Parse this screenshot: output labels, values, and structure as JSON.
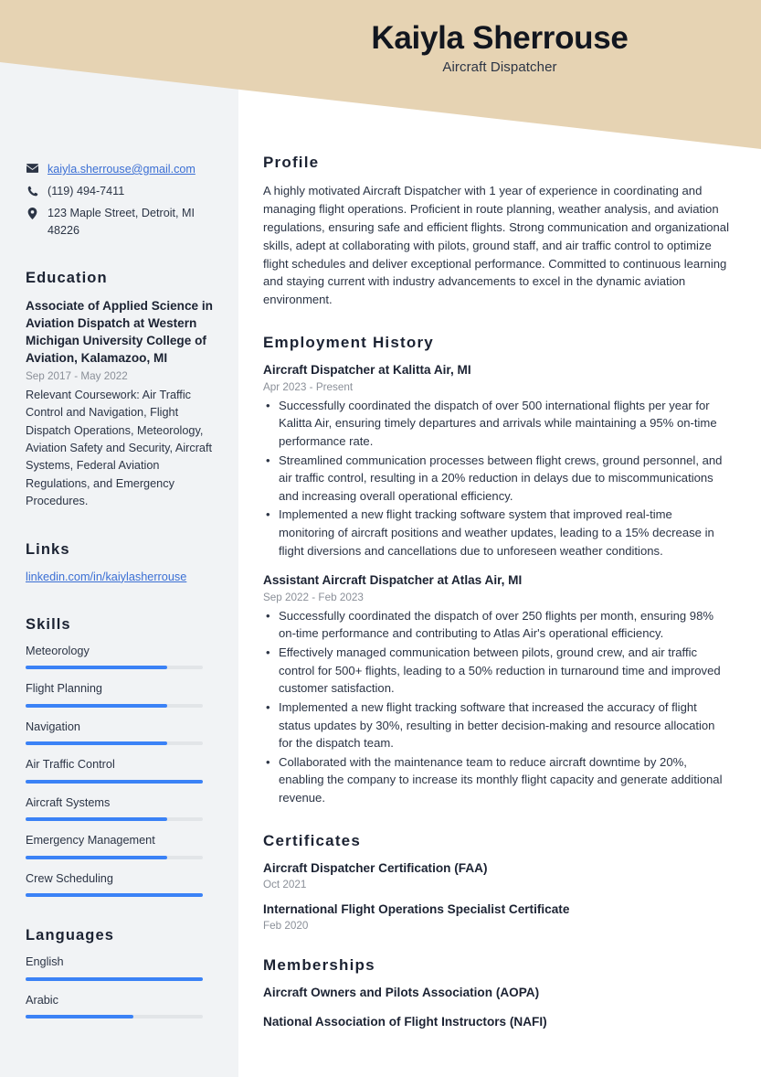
{
  "header": {
    "name": "Kaiyla Sherrouse",
    "job_title": "Aircraft Dispatcher",
    "banner_color": "#e6d3b3"
  },
  "theme": {
    "accent": "#3b82f6",
    "link": "#3b6fd4",
    "sidebar_bg": "#f1f3f5",
    "heading": "#1b2232",
    "muted": "#8b9099"
  },
  "sidebar": {
    "contact": [
      {
        "icon": "envelope-icon",
        "text": "kaiyla.sherrouse@gmail.com",
        "is_link": true
      },
      {
        "icon": "phone-icon",
        "text": "(119) 494-7411",
        "is_link": false
      },
      {
        "icon": "location-pin-icon",
        "text": "123 Maple Street, Detroit, MI 48226",
        "is_link": false
      }
    ],
    "education": {
      "heading": "Education",
      "degree": "Associate of Applied Science in Aviation Dispatch at Western Michigan University College of Aviation, Kalamazoo, MI",
      "date": "Sep 2017 - May 2022",
      "description": "Relevant Coursework: Air Traffic Control and Navigation, Flight Dispatch Operations, Meteorology, Aviation Safety and Security, Aircraft Systems, Federal Aviation Regulations, and Emergency Procedures."
    },
    "links": {
      "heading": "Links",
      "items": [
        {
          "label": "linkedin.com/in/kaiylasherrouse"
        }
      ]
    },
    "skills": {
      "heading": "Skills",
      "items": [
        {
          "label": "Meteorology",
          "level": 80
        },
        {
          "label": "Flight Planning",
          "level": 80
        },
        {
          "label": "Navigation",
          "level": 80
        },
        {
          "label": "Air Traffic Control",
          "level": 100
        },
        {
          "label": "Aircraft Systems",
          "level": 80
        },
        {
          "label": "Emergency Management",
          "level": 80
        },
        {
          "label": "Crew Scheduling",
          "level": 100
        }
      ]
    },
    "languages": {
      "heading": "Languages",
      "items": [
        {
          "label": "English",
          "level": 100
        },
        {
          "label": "Arabic",
          "level": 61
        }
      ]
    }
  },
  "main": {
    "profile": {
      "heading": "Profile",
      "text": "A highly motivated Aircraft Dispatcher with 1 year of experience in coordinating and managing flight operations. Proficient in route planning, weather analysis, and aviation regulations, ensuring safe and efficient flights. Strong communication and organizational skills, adept at collaborating with pilots, ground staff, and air traffic control to optimize flight schedules and deliver exceptional performance. Committed to continuous learning and staying current with industry advancements to excel in the dynamic aviation environment."
    },
    "employment": {
      "heading": "Employment History",
      "jobs": [
        {
          "title": "Aircraft Dispatcher at Kalitta Air, MI",
          "date": "Apr 2023 - Present",
          "bullets": [
            "Successfully coordinated the dispatch of over 500 international flights per year for Kalitta Air, ensuring timely departures and arrivals while maintaining a 95% on-time performance rate.",
            "Streamlined communication processes between flight crews, ground personnel, and air traffic control, resulting in a 20% reduction in delays due to miscommunications and increasing overall operational efficiency.",
            "Implemented a new flight tracking software system that improved real-time monitoring of aircraft positions and weather updates, leading to a 15% decrease in flight diversions and cancellations due to unforeseen weather conditions."
          ]
        },
        {
          "title": "Assistant Aircraft Dispatcher at Atlas Air, MI",
          "date": "Sep 2022 - Feb 2023",
          "bullets": [
            "Successfully coordinated the dispatch of over 250 flights per month, ensuring 98% on-time performance and contributing to Atlas Air's operational efficiency.",
            "Effectively managed communication between pilots, ground crew, and air traffic control for 500+ flights, leading to a 50% reduction in turnaround time and improved customer satisfaction.",
            "Implemented a new flight tracking software that increased the accuracy of flight status updates by 30%, resulting in better decision-making and resource allocation for the dispatch team.",
            "Collaborated with the maintenance team to reduce aircraft downtime by 20%, enabling the company to increase its monthly flight capacity and generate additional revenue."
          ]
        }
      ]
    },
    "certificates": {
      "heading": "Certificates",
      "items": [
        {
          "title": "Aircraft Dispatcher Certification (FAA)",
          "date": "Oct 2021"
        },
        {
          "title": "International Flight Operations Specialist Certificate",
          "date": "Feb 2020"
        }
      ]
    },
    "memberships": {
      "heading": "Memberships",
      "items": [
        {
          "title": "Aircraft Owners and Pilots Association (AOPA)"
        },
        {
          "title": "National Association of Flight Instructors (NAFI)"
        }
      ]
    }
  }
}
